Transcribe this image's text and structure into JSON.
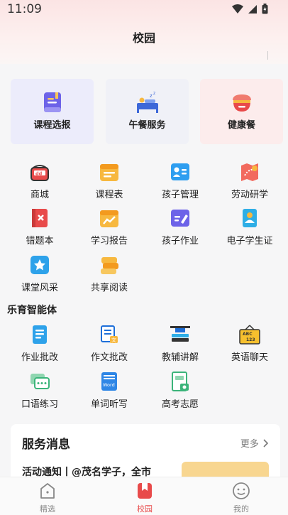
{
  "status_bar": {
    "time": "11:09"
  },
  "header": {
    "title": "校园"
  },
  "top_cards": [
    {
      "label": "课程选报",
      "icon": "course-book-icon",
      "bg": "#ececfb"
    },
    {
      "label": "午餐服务",
      "icon": "lunch-service-icon",
      "bg": "#f0f1f7"
    },
    {
      "label": "健康餐",
      "icon": "health-meal-icon",
      "bg": "#fcecec"
    }
  ],
  "grid": [
    {
      "label": "商城",
      "icon": "mall-icon"
    },
    {
      "label": "课程表",
      "icon": "schedule-icon"
    },
    {
      "label": "孩子管理",
      "icon": "child-management-icon"
    },
    {
      "label": "劳动研学",
      "icon": "labor-study-icon"
    },
    {
      "label": "错题本",
      "icon": "mistake-book-icon"
    },
    {
      "label": "学习报告",
      "icon": "study-report-icon"
    },
    {
      "label": "孩子作业",
      "icon": "homework-icon"
    },
    {
      "label": "电子学生证",
      "icon": "student-id-icon"
    },
    {
      "label": "课堂风采",
      "icon": "classroom-style-icon"
    },
    {
      "label": "共享阅读",
      "icon": "shared-reading-icon"
    }
  ],
  "ai_section": {
    "title": "乐育智能体",
    "items": [
      {
        "label": "作业批改",
        "icon": "homework-grading-icon"
      },
      {
        "label": "作文批改",
        "icon": "essay-grading-icon"
      },
      {
        "label": "教辅讲解",
        "icon": "tutoring-icon"
      },
      {
        "label": "英语聊天",
        "icon": "english-chat-icon"
      },
      {
        "label": "口语练习",
        "icon": "oral-practice-icon"
      },
      {
        "label": "单词听写",
        "icon": "word-dictation-icon"
      },
      {
        "label": "高考志愿",
        "icon": "college-application-icon"
      }
    ]
  },
  "news": {
    "title": "服务消息",
    "more": "更多",
    "headline": "活动通知丨@茂名学子，全市"
  },
  "tabbar": [
    {
      "label": "精选",
      "icon": "home-icon",
      "active": false
    },
    {
      "label": "校园",
      "icon": "campus-icon",
      "active": true
    },
    {
      "label": "我的",
      "icon": "profile-smile-icon",
      "active": false
    }
  ],
  "colors": {
    "accent": "#e84a4a",
    "title": "#222222"
  }
}
